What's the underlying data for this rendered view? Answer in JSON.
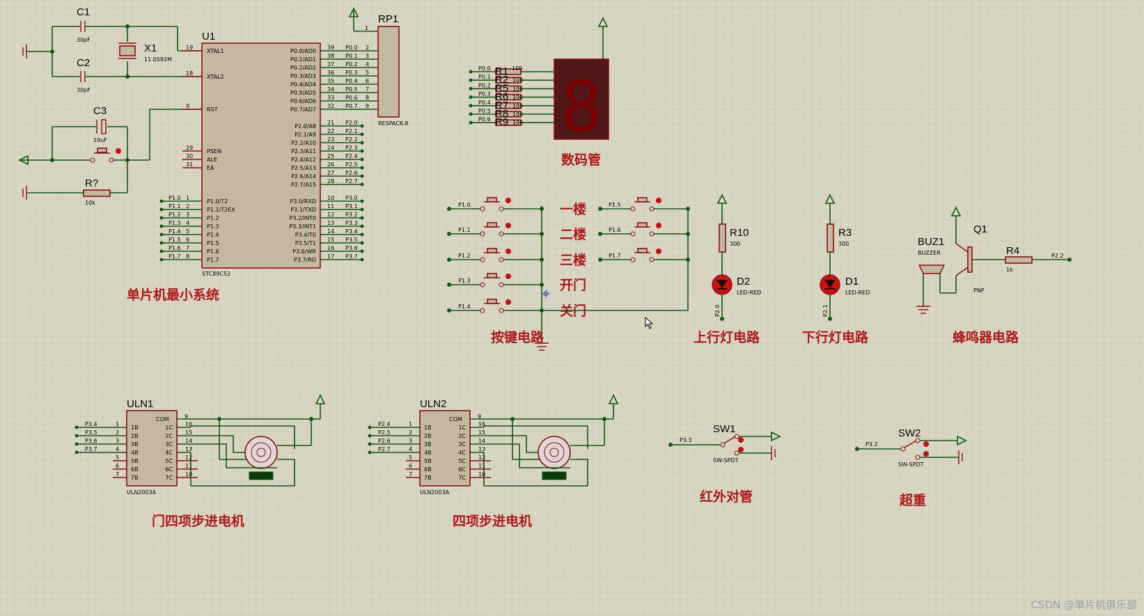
{
  "components": {
    "c1": {
      "ref": "C1",
      "value": "30pF"
    },
    "c2": {
      "ref": "C2",
      "value": "30pF"
    },
    "c3": {
      "ref": "C3",
      "value": "10uF"
    },
    "x1": {
      "ref": "X1",
      "value": "11.0592M"
    },
    "rq": {
      "ref": "R?",
      "value": "10k"
    },
    "u1": {
      "ref": "U1",
      "part": "STC89C52"
    },
    "rp1": {
      "ref": "RP1",
      "part": "RESPACK-8",
      "pin1": "1"
    },
    "r1": {
      "ref": "R1",
      "value": "100"
    },
    "r10": {
      "ref": "R10",
      "value": "300"
    },
    "r3": {
      "ref": "R3",
      "value": "300"
    },
    "d2": {
      "ref": "D2",
      "part": "LED-RED",
      "net": "P2.0"
    },
    "d1": {
      "ref": "D1",
      "part": "LED-RED",
      "net": "P2.1"
    },
    "buz1": {
      "ref": "BUZ1",
      "part": "BUZZER"
    },
    "q1": {
      "ref": "Q1",
      "part": "PNP"
    },
    "r4": {
      "ref": "R4",
      "value": "1k",
      "net": "P2.2"
    },
    "uln1": {
      "ref": "ULN1",
      "part": "ULN2003A",
      "com": "COM",
      "pin_com": "9"
    },
    "uln2": {
      "ref": "ULN2",
      "part": "ULN2003A",
      "com": "COM",
      "pin_com": "9"
    },
    "sw1": {
      "ref": "SW1",
      "part": "SW-SPDT",
      "net": "P3.3"
    },
    "sw2": {
      "ref": "SW2",
      "part": "SW-SPDT",
      "net": "P3.2"
    }
  },
  "u1_pins": {
    "left": [
      {
        "num": "19",
        "name": "XTAL1"
      },
      {
        "num": "18",
        "name": "XTAL2"
      },
      {
        "num": "9",
        "name": "RST"
      },
      {
        "num": "29",
        "name": "PSEN"
      },
      {
        "num": "30",
        "name": "ALE"
      },
      {
        "num": "31",
        "name": "EA"
      },
      {
        "num": "1",
        "name": "P1.0/T2",
        "net": "P1.0"
      },
      {
        "num": "2",
        "name": "P1.1/T2EX",
        "net": "P1.1"
      },
      {
        "num": "3",
        "name": "P1.2",
        "net": "P1.2"
      },
      {
        "num": "4",
        "name": "P1.3",
        "net": "P1.3"
      },
      {
        "num": "5",
        "name": "P1.4",
        "net": "P1.4"
      },
      {
        "num": "6",
        "name": "P1.5",
        "net": "P1.5"
      },
      {
        "num": "7",
        "name": "P1.6",
        "net": "P1.6"
      },
      {
        "num": "8",
        "name": "P1.7",
        "net": "P1.7"
      }
    ],
    "right_p0": [
      {
        "num": "39",
        "name": "P0.0/AD0",
        "net": "P0.0",
        "rp": "2"
      },
      {
        "num": "38",
        "name": "P0.1/AD1",
        "net": "P0.1",
        "rp": "3"
      },
      {
        "num": "37",
        "name": "P0.2/AD2",
        "net": "P0.2",
        "rp": "4"
      },
      {
        "num": "36",
        "name": "P0.3/AD3",
        "net": "P0.3",
        "rp": "5"
      },
      {
        "num": "35",
        "name": "P0.4/AD4",
        "net": "P0.4",
        "rp": "6"
      },
      {
        "num": "34",
        "name": "P0.5/AD5",
        "net": "P0.5",
        "rp": "7"
      },
      {
        "num": "33",
        "name": "P0.6/AD6",
        "net": "P0.6",
        "rp": "8"
      },
      {
        "num": "32",
        "name": "P0.7/AD7",
        "net": "P0.7",
        "rp": "9"
      }
    ],
    "right_p2": [
      {
        "num": "21",
        "name": "P2.0/A8",
        "net": "P2.0"
      },
      {
        "num": "22",
        "name": "P2.1/A9",
        "net": "P2.1"
      },
      {
        "num": "23",
        "name": "P2.2/A10",
        "net": "P2.2"
      },
      {
        "num": "24",
        "name": "P2.3/A11",
        "net": "P2.3"
      },
      {
        "num": "25",
        "name": "P2.4/A12",
        "net": "P2.4"
      },
      {
        "num": "26",
        "name": "P2.5/A13",
        "net": "P2.5"
      },
      {
        "num": "27",
        "name": "P2.6/A14",
        "net": "P2.6"
      },
      {
        "num": "28",
        "name": "P2.7/A15",
        "net": "P2.7"
      }
    ],
    "right_p3": [
      {
        "num": "10",
        "name": "P3.0/RXD",
        "net": "P3.0"
      },
      {
        "num": "11",
        "name": "P3.1/TXD",
        "net": "P3.1"
      },
      {
        "num": "12",
        "name": "P3.2/INT0",
        "net": "P3.2"
      },
      {
        "num": "13",
        "name": "P3.3/INT1",
        "net": "P3.3"
      },
      {
        "num": "14",
        "name": "P3.4/T0",
        "net": "P3.4"
      },
      {
        "num": "15",
        "name": "P3.5/T1",
        "net": "P3.5"
      },
      {
        "num": "16",
        "name": "P3.6/WR",
        "net": "P3.6"
      },
      {
        "num": "17",
        "name": "P3.7/RD",
        "net": "P3.7"
      }
    ]
  },
  "seg_nets": [
    "P0.0",
    "P0.1",
    "P0.2",
    "P0.3",
    "P0.4",
    "P0.5",
    "P0.6"
  ],
  "seg_res_refs": [
    "R1",
    "R2",
    "R5",
    "R6",
    "R7",
    "R8",
    "R9"
  ],
  "seg_res_value": "100",
  "seg_digit": "8",
  "buttons_left": [
    {
      "net": "P1.0",
      "floor": "一楼"
    },
    {
      "net": "P1.1",
      "floor": "二楼"
    },
    {
      "net": "P1.2",
      "floor": "三楼"
    },
    {
      "net": "P1.3",
      "floor": "开门"
    },
    {
      "net": "P1.4",
      "floor": "关门"
    }
  ],
  "buttons_right": [
    {
      "net": "P1.5"
    },
    {
      "net": "P1.6"
    },
    {
      "net": "P1.7"
    }
  ],
  "uln1_in": [
    {
      "net": "P3.4",
      "num": "1",
      "name": "1B"
    },
    {
      "net": "P3.5",
      "num": "2",
      "name": "2B"
    },
    {
      "net": "P3.6",
      "num": "3",
      "name": "3B"
    },
    {
      "net": "P3.7",
      "num": "4",
      "name": "4B"
    },
    {
      "net": "",
      "num": "5",
      "name": "5B"
    },
    {
      "net": "",
      "num": "6",
      "name": "6B"
    },
    {
      "net": "",
      "num": "7",
      "name": "7B"
    }
  ],
  "uln2_in": [
    {
      "net": "P2.4",
      "num": "1",
      "name": "1B"
    },
    {
      "net": "P2.5",
      "num": "2",
      "name": "2B"
    },
    {
      "net": "P2.6",
      "num": "3",
      "name": "3B"
    },
    {
      "net": "P2.7",
      "num": "4",
      "name": "4B"
    },
    {
      "net": "",
      "num": "5",
      "name": "5B"
    },
    {
      "net": "",
      "num": "6",
      "name": "6B"
    },
    {
      "net": "",
      "num": "7",
      "name": "7B"
    }
  ],
  "uln_out": [
    {
      "num": "16",
      "name": "1C"
    },
    {
      "num": "15",
      "name": "2C"
    },
    {
      "num": "14",
      "name": "3C"
    },
    {
      "num": "13",
      "name": "4C"
    },
    {
      "num": "12",
      "name": "5C"
    },
    {
      "num": "11",
      "name": "6C"
    },
    {
      "num": "10",
      "name": "7C"
    }
  ],
  "sections": {
    "mcu": "单片机最小系统",
    "display": "数码管",
    "keys": "按键电路",
    "up_light": "上行灯电路",
    "down_light": "下行灯电路",
    "buzzer": "蜂鸣器电路",
    "door_motor": "门四项步进电机",
    "motor": "四项步进电机",
    "ir": "红外对管",
    "overweight": "超重"
  },
  "watermark": "CSDN @单片机俱乐部",
  "colors": {
    "sheet": "#d8d5c2",
    "wire": "#0f5a0f",
    "component": "#8a1010",
    "label": "#b01818",
    "segment_off": "#7a0000"
  }
}
